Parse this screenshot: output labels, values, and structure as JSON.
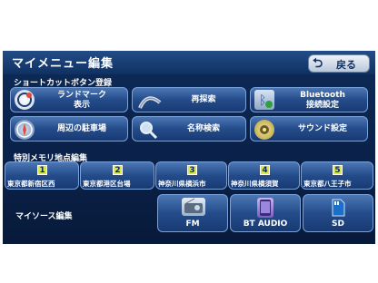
{
  "header": {
    "title": "マイメニュー編集",
    "back_label": "戻る"
  },
  "shortcut_section": {
    "label": "ショートカットボタン登録"
  },
  "shortcuts": [
    {
      "label_line1": "ランドマーク",
      "label_line2": "表示",
      "icon": "landmark-icon"
    },
    {
      "label_line1": "再探索",
      "label_line2": "",
      "icon": "reroute-icon"
    },
    {
      "label_line1": "Bluetooth",
      "label_line2": "接続設定",
      "icon": "bluetooth-settings-icon"
    },
    {
      "label_line1": "周辺の駐車場",
      "label_line2": "",
      "icon": "parking-icon"
    },
    {
      "label_line1": "名称検索",
      "label_line2": "",
      "icon": "search-icon"
    },
    {
      "label_line1": "サウンド設定",
      "label_line2": "",
      "icon": "speaker-icon"
    }
  ],
  "memory_section": {
    "label": "特別メモリ地点編集"
  },
  "memory_points": [
    {
      "number": "1",
      "name": "東京都新宿区西"
    },
    {
      "number": "2",
      "name": "東京都港区台場"
    },
    {
      "number": "3",
      "name": "神奈川県横浜市"
    },
    {
      "number": "4",
      "name": "神奈川県横須賀"
    },
    {
      "number": "5",
      "name": "東京都八王子市"
    }
  ],
  "source_section": {
    "label": "マイソース編集"
  },
  "sources": [
    {
      "label": "FM",
      "icon": "radio-icon"
    },
    {
      "label": "BT AUDIO",
      "icon": "phone-icon"
    },
    {
      "label": "SD",
      "icon": "sd-card-icon"
    }
  ]
}
